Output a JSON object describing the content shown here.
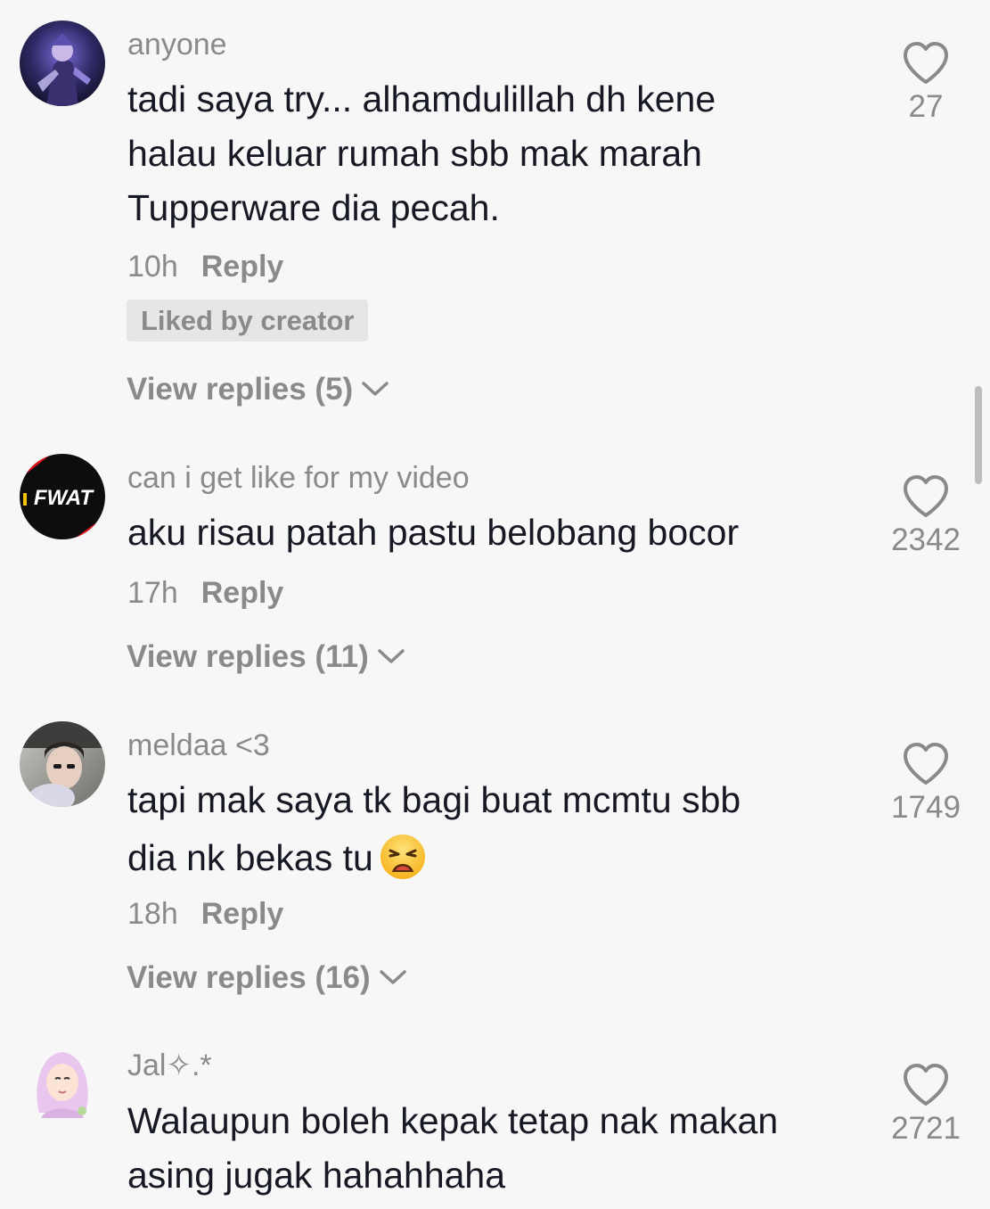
{
  "comments": [
    {
      "username": "anyone",
      "lines": [
        "tadi saya try... alhamdulillah dh kene",
        "halau keluar rumah sbb mak marah",
        "Tupperware dia pecah."
      ],
      "time": "10h",
      "reply_label": "Reply",
      "badge": "Liked by creator",
      "view_replies": "View replies (5)",
      "likes": "27"
    },
    {
      "username": "can i get like for my video",
      "lines": [
        "aku risau patah pastu belobang bocor"
      ],
      "time": "17h",
      "reply_label": "Reply",
      "view_replies": "View replies (11)",
      "likes": "2342",
      "avatar_text": "FWAT"
    },
    {
      "username": "meldaa <3",
      "lines": [
        "tapi mak saya tk bagi buat mcmtu sbb",
        "dia nk bekas tu"
      ],
      "emoji": "weary-face",
      "time": "18h",
      "reply_label": "Reply",
      "view_replies": "View replies (16)",
      "likes": "1749"
    },
    {
      "username": "Jal✧.*",
      "lines": [
        "Walaupun boleh kepak tetap nak makan",
        "asing jugak hahahhaha"
      ],
      "likes": "2721"
    }
  ],
  "icons": {
    "like": "heart-outline-icon",
    "expand": "chevron-down-icon"
  },
  "colors": {
    "background": "#f7f7f7",
    "text": "#161823",
    "muted": "#8a8a8a",
    "badge_bg": "#e6e6e6",
    "fwat_red": "#e0141e"
  }
}
